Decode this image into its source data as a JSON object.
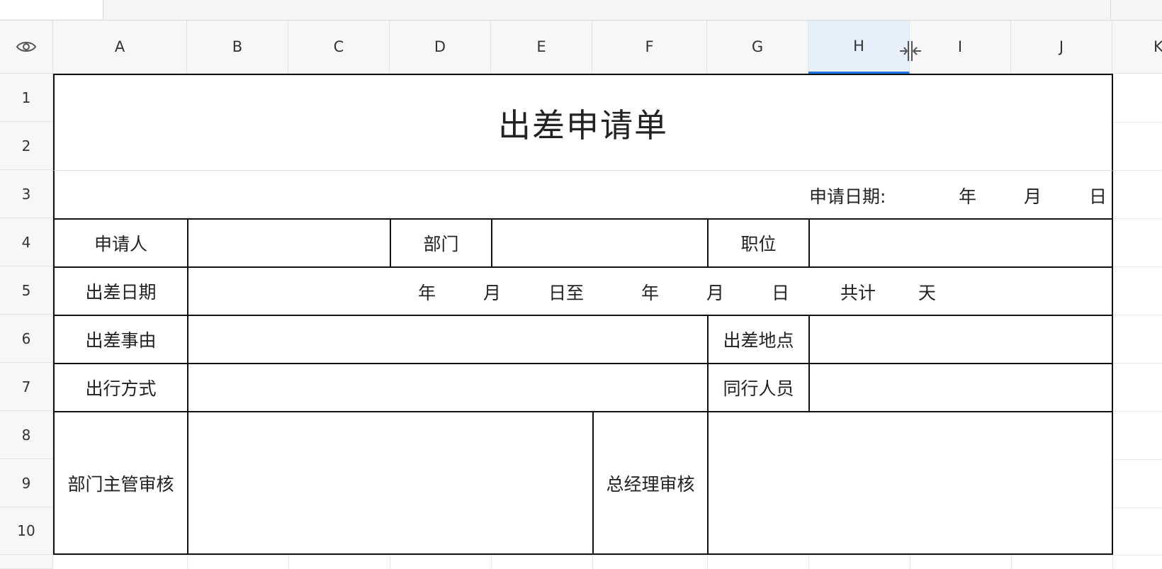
{
  "columns": [
    "A",
    "B",
    "C",
    "D",
    "E",
    "F",
    "G",
    "H",
    "I",
    "J",
    "K"
  ],
  "rows": [
    "1",
    "2",
    "3",
    "4",
    "5",
    "6",
    "7",
    "8",
    "9",
    "10"
  ],
  "selected_column": "H",
  "icons": {
    "visibility": "eye-icon",
    "resize": "column-resize-cursor-icon"
  },
  "form": {
    "title": "出差申请单",
    "apply_date": {
      "label": "申请日期:",
      "year": "年",
      "month": "月",
      "day": "日"
    },
    "applicant_label": "申请人",
    "department_label": "部门",
    "position_label": "职位",
    "trip_dates": {
      "label": "出差日期",
      "year1": "年",
      "month1": "月",
      "day1_to": "日至",
      "year2": "年",
      "month2": "月",
      "day2": "日",
      "total": "共计",
      "days": "天"
    },
    "reason_label": "出差事由",
    "location_label": "出差地点",
    "travel_mode_label": "出行方式",
    "companions_label": "同行人员",
    "dept_manager_review_label": "部门主管审核",
    "gm_review_label": "总经理审核"
  },
  "colors": {
    "selected_header": "#e6f0fb",
    "accent": "#1a73e8",
    "border": "#111111"
  }
}
